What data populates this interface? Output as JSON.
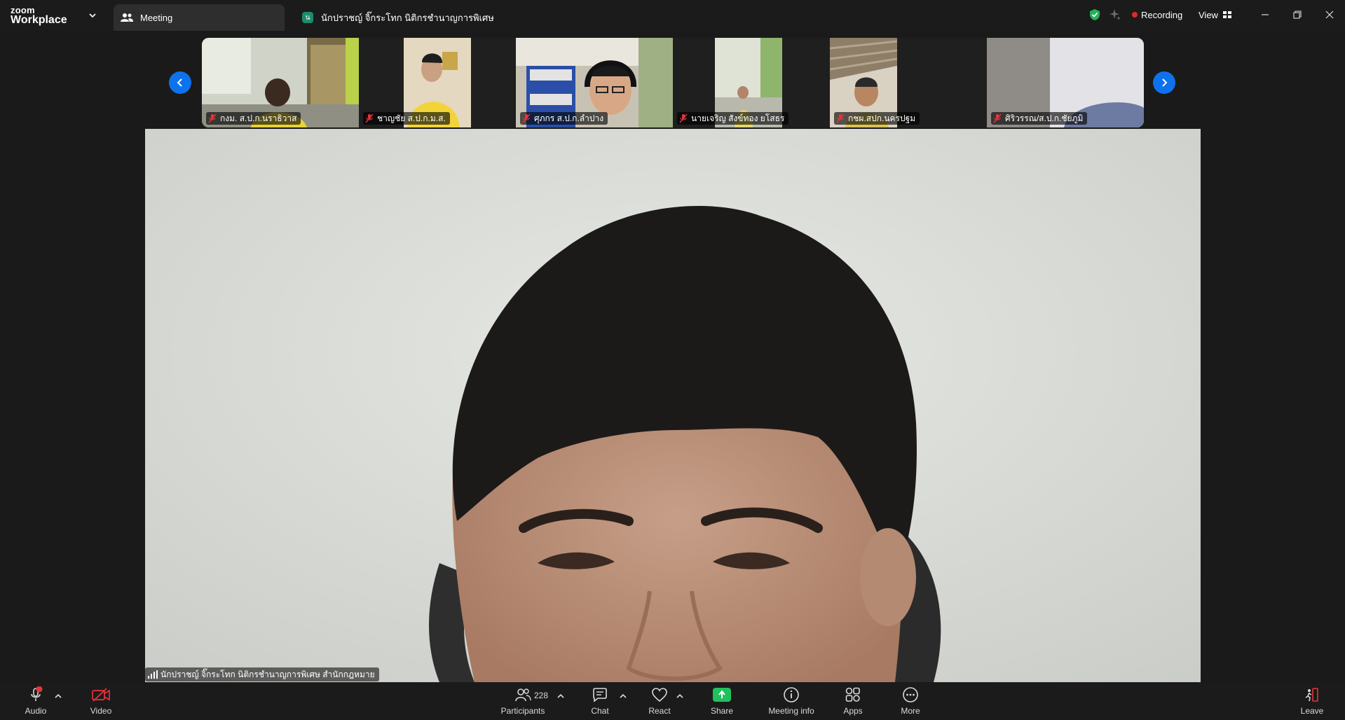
{
  "titlebar": {
    "brand_top": "zoom",
    "brand_bottom": "Workplace",
    "tabs": [
      {
        "label": "Meeting"
      },
      {
        "label": "นักปราชญ์ จิ๊กระโทก นิติกรชำนาญการพิเศษ",
        "badge": "น"
      }
    ],
    "recording_label": "Recording",
    "view_label": "View"
  },
  "thumbnails": [
    {
      "name": "กงม. ส.ป.ก.นราธิวาส",
      "muted": true
    },
    {
      "name": "ชาญชัย ส.ป.ก.ม.ส.",
      "muted": true
    },
    {
      "name": "ศุภกร ส.ป.ก.ลำปาง",
      "muted": true
    },
    {
      "name": "นายเจริญ สังข์ทอง ยโสธร",
      "muted": true
    },
    {
      "name": "กชผ.สปก.นครปฐม",
      "muted": true
    },
    {
      "name": "ศิริวรรณ/ส.ป.ก.ชัยภูมิ",
      "muted": true
    }
  ],
  "main": {
    "speaker_name": "นักปราชญ์ จิ๊กระโทก นิติกรชำนาญการพิเศษ สำนักกฎหมาย"
  },
  "toolbar": {
    "audio": "Audio",
    "video": "Video",
    "participants": "Participants",
    "participants_count": "228",
    "chat": "Chat",
    "react": "React",
    "share": "Share",
    "meeting_info": "Meeting info",
    "apps": "Apps",
    "more": "More",
    "leave": "Leave"
  },
  "colors": {
    "accent_blue": "#0e72ed",
    "share_green": "#21c05c",
    "recording_red": "#e02828",
    "muted_red": "#e8343b",
    "badge_green": "#1c8c6c"
  }
}
